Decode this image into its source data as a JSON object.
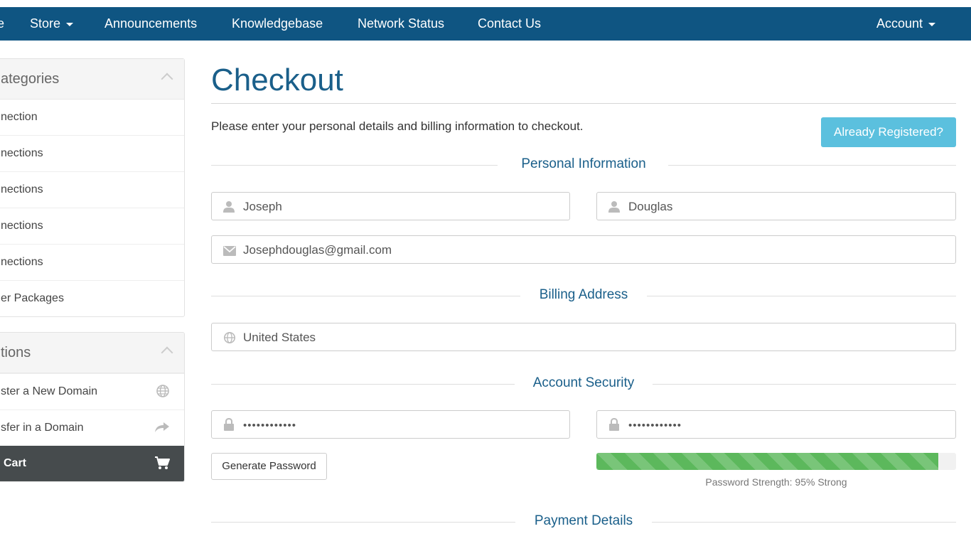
{
  "nav": {
    "home_fragment": "e",
    "store": "Store",
    "announcements": "Announcements",
    "knowledgebase": "Knowledgebase",
    "network_status": "Network Status",
    "contact_us": "Contact Us",
    "account": "Account"
  },
  "sidebar": {
    "categories": {
      "title": "ategories",
      "items": [
        {
          "label": "nection"
        },
        {
          "label": "nections"
        },
        {
          "label": "nections"
        },
        {
          "label": "nections"
        },
        {
          "label": "nections"
        },
        {
          "label": "er Packages"
        }
      ]
    },
    "actions": {
      "title": "tions",
      "items": [
        {
          "label": "ster a New Domain",
          "icon": "globe-icon"
        },
        {
          "label": "sfer in a Domain",
          "icon": "share-arrow-icon"
        },
        {
          "label": "Cart",
          "icon": "cart-icon",
          "active": true
        }
      ]
    }
  },
  "main": {
    "title": "Checkout",
    "intro": "Please enter your personal details and billing information to checkout.",
    "already_registered": "Already Registered?",
    "sections": {
      "personal": "Personal Information",
      "billing": "Billing Address",
      "security": "Account Security",
      "payment": "Payment Details"
    },
    "fields": {
      "first_name": "Joseph",
      "last_name": "Douglas",
      "email": "Josephdouglas@gmail.com",
      "country": "United States",
      "password": "••••••••••••",
      "password_confirm": "••••••••••••"
    },
    "generate_password": "Generate Password",
    "password_strength": {
      "percent": 95,
      "label": "Password Strength: 95% Strong"
    }
  },
  "colors": {
    "navbar": "#0f5582",
    "accent": "#1a5f8a",
    "info_button": "#5bc0de",
    "success": "#5cb85c",
    "active_sidebar": "#464b4d"
  }
}
